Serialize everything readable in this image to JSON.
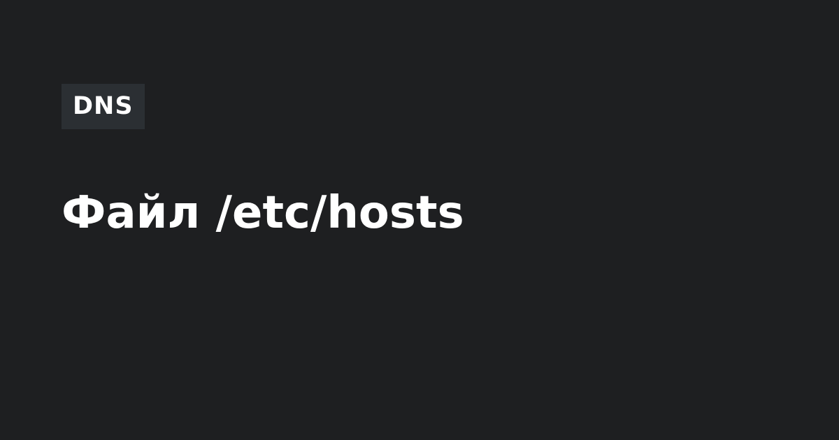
{
  "tag": {
    "label": "DNS"
  },
  "title": "Файл /etc/hosts",
  "colors": {
    "background": "#1e1f21",
    "tag_background": "#2b2f33",
    "text": "#ffffff"
  }
}
